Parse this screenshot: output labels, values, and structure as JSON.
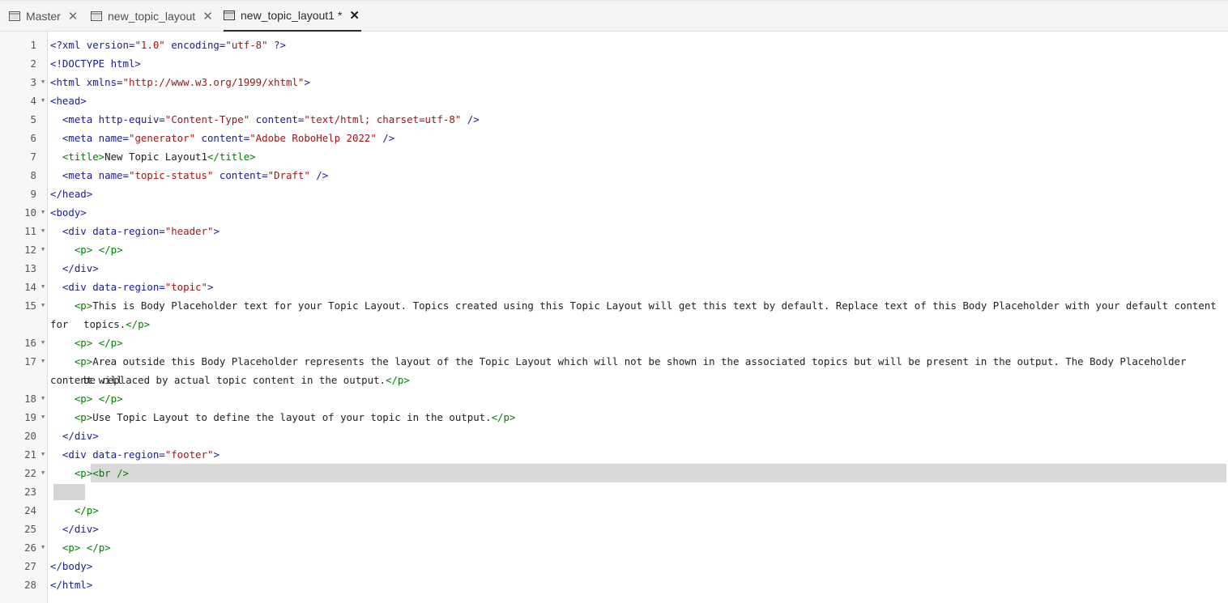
{
  "tabs": [
    {
      "label": "Master",
      "active": false
    },
    {
      "label": "new_topic_layout",
      "active": false
    },
    {
      "label": "new_topic_layout1 *",
      "active": true
    }
  ],
  "close_glyph": "✕",
  "lines": [
    {
      "n": "1",
      "fold": false,
      "text": "<?xml version=\"1.0\" encoding=\"utf-8\" ?>"
    },
    {
      "n": "2",
      "fold": false,
      "text": "<!DOCTYPE html>"
    },
    {
      "n": "3",
      "fold": true,
      "text": "<html xmlns=\"http://www.w3.org/1999/xhtml\">"
    },
    {
      "n": "4",
      "fold": true,
      "text": "<head>"
    },
    {
      "n": "5",
      "fold": false,
      "text": "  <meta http-equiv=\"Content-Type\" content=\"text/html; charset=utf-8\" />"
    },
    {
      "n": "6",
      "fold": false,
      "text": "  <meta name=\"generator\" content=\"Adobe RoboHelp 2022\" />"
    },
    {
      "n": "7",
      "fold": false,
      "text": "  <title>New Topic Layout1</title>"
    },
    {
      "n": "8",
      "fold": false,
      "text": "  <meta name=\"topic-status\" content=\"Draft\" />"
    },
    {
      "n": "9",
      "fold": false,
      "text": "</head>"
    },
    {
      "n": "10",
      "fold": true,
      "text": "<body>"
    },
    {
      "n": "11",
      "fold": true,
      "text": "  <div data-region=\"header\">"
    },
    {
      "n": "12",
      "fold": true,
      "text": "    <p> </p>"
    },
    {
      "n": "13",
      "fold": false,
      "text": "  </div>"
    },
    {
      "n": "14",
      "fold": true,
      "text": "  <div data-region=\"topic\">"
    },
    {
      "n": "15",
      "fold": true,
      "text": "    <p>This is Body Placeholder text for your Topic Layout. Topics created using this Topic Layout will get this text by default. Replace text of this Body Placeholder with your default content for",
      "cont": "topics.</p>"
    },
    {
      "n": "16",
      "fold": true,
      "text": "    <p> </p>"
    },
    {
      "n": "17",
      "fold": true,
      "text": "    <p>Area outside this Body Placeholder represents the layout of the Topic Layout which will not be shown in the associated topics but will be present in the output. The Body Placeholder content will",
      "cont": "be replaced by actual topic content in the output.</p>"
    },
    {
      "n": "18",
      "fold": true,
      "text": "    <p> </p>"
    },
    {
      "n": "19",
      "fold": true,
      "text": "    <p>Use Topic Layout to define the layout of your topic in the output.</p>"
    },
    {
      "n": "20",
      "fold": false,
      "text": "  </div>"
    },
    {
      "n": "21",
      "fold": true,
      "text": "  <div data-region=\"footer\">"
    },
    {
      "n": "22",
      "fold": true,
      "text": "    <p><br />"
    },
    {
      "n": "23",
      "fold": false,
      "text": ""
    },
    {
      "n": "24",
      "fold": false,
      "text": "    </p>"
    },
    {
      "n": "25",
      "fold": false,
      "text": "  </div>"
    },
    {
      "n": "26",
      "fold": true,
      "text": "  <p> </p>"
    },
    {
      "n": "27",
      "fold": false,
      "text": "</body>"
    },
    {
      "n": "28",
      "fold": false,
      "text": "</html>"
    }
  ],
  "colors": {
    "tag": "#1a1a9e",
    "value": "#a31515",
    "paragraph": "#008000",
    "highlight": "#d9d9d9"
  },
  "icons": {
    "tab": "layout-window-icon",
    "fold": "triangle-down-icon"
  }
}
